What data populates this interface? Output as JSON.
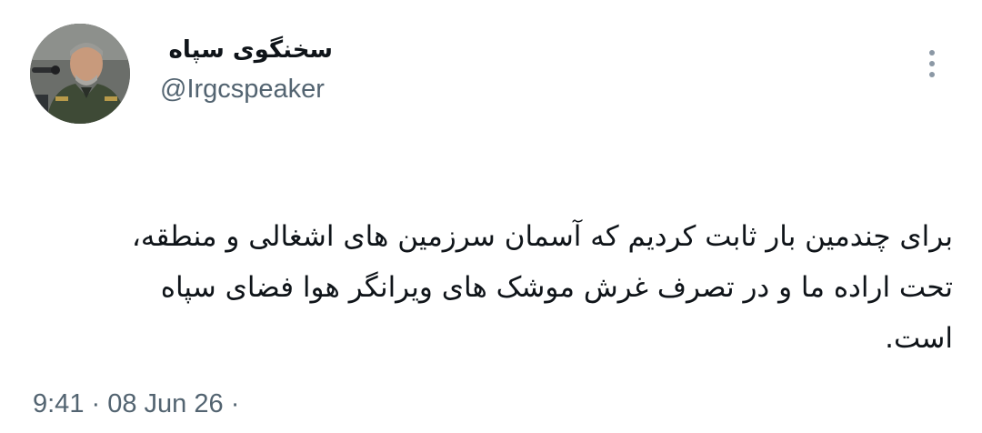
{
  "author": {
    "name": "سخنگوی سپاه",
    "handle": "@Irgcspeaker",
    "avatar_icon": "profile-photo"
  },
  "menu": {
    "icon": "more-vertical-icon"
  },
  "tweet": {
    "lines": [
      "برای چندمین بار ثابت کردیم که آسمان سرزمین های اشغالی و منطقه،",
      "تحت اراده ما و در تصرف غرش موشک های ویرانگر هوا فضای سپاه",
      "است."
    ]
  },
  "meta": {
    "time": "9:41",
    "separator": "·",
    "date": "08 Jun 26",
    "trailing": "·"
  },
  "colors": {
    "text": "#0f1419",
    "secondary": "#536471",
    "dots": "#8b98a5"
  }
}
